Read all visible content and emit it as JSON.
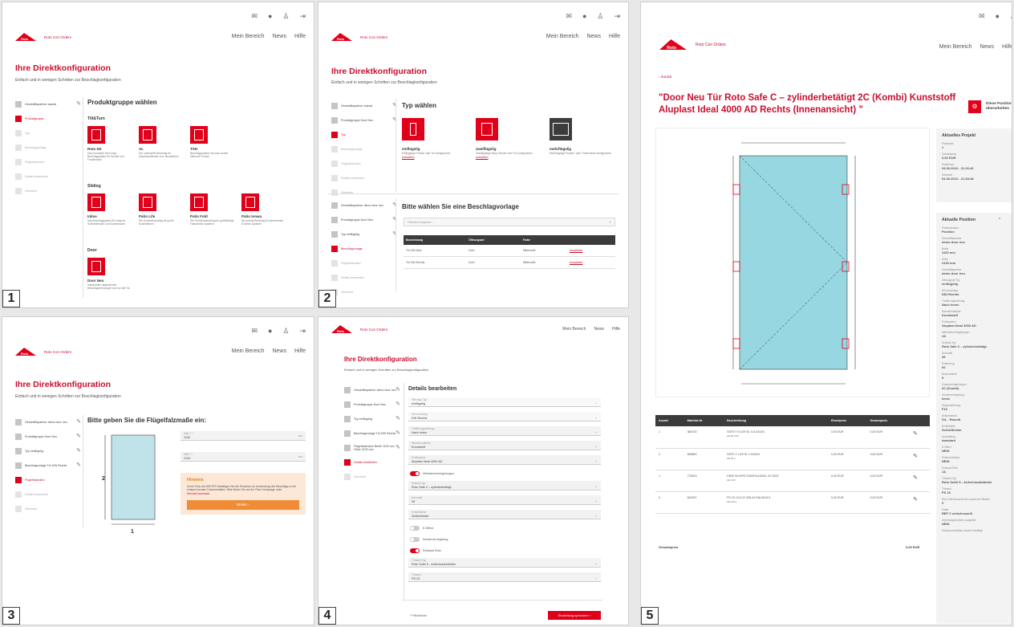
{
  "header": {
    "brand": "Roto Con Orders",
    "nav": [
      "Mein Bereich",
      "News",
      "Hilfe"
    ],
    "icons": [
      "mail-icon",
      "globe-icon",
      "user-icon",
      "logout-icon"
    ]
  },
  "heading": "Ihre Direktkonfiguration",
  "subheading": "Einfach und in wenigen Schritten zur Beschlagkonfiguration",
  "panel_numbers": [
    "1",
    "2",
    "3",
    "4",
    "5"
  ],
  "p1": {
    "steps": [
      {
        "label": "Geschäftspartner auswä",
        "state": "done",
        "edit": true
      },
      {
        "label": "Produktgruppe",
        "state": "active",
        "edit": false
      },
      {
        "label": "Typ",
        "state": "todo",
        "edit": false
      },
      {
        "label": "Beschlagvorlage",
        "state": "todo",
        "edit": false
      },
      {
        "label": "Flügelfalzmaße",
        "state": "todo",
        "edit": false
      },
      {
        "label": "Details bearbeiten",
        "state": "todo",
        "edit": false
      },
      {
        "label": "Übersicht",
        "state": "todo",
        "edit": false
      }
    ],
    "title": "Produktgruppe wählen",
    "groups": [
      {
        "title": "Tilt&Turn",
        "items": [
          {
            "name": "Roto NX",
            "desc": "Das innovative Dreh-Kipp-Beschlagsystem für Fenster und Fenstertüren"
          },
          {
            "name": "AL",
            "desc": "Der universelle Beschlag für Aluminiumfenster und -fenstertüren"
          },
          {
            "name": "TSH",
            "desc": "Beschlagsysteme für nach außen öffnende Fenster"
          }
        ]
      },
      {
        "title": "Sliding",
        "items": [
          {
            "name": "Inline",
            "desc": "Das Beschlagsystem für einfache Schiebefenster und Schiebetüren"
          },
          {
            "name": "Patio Life",
            "desc": "Der Komfortbeschlag für große Schiebetüren"
          },
          {
            "name": "Patio Fold",
            "desc": "Der Premiumbeschlag für großflächige Faltschiebe-Systeme"
          },
          {
            "name": "Patio Inowa",
            "desc": "Die smarte Beschlag für barrierefreie Schiebe-Systeme"
          }
        ]
      },
      {
        "title": "Door",
        "items": [
          {
            "name": "Door Neu",
            "desc": "Individueller abgestimmte Beschlagtechnologie rund um die Tür"
          }
        ]
      }
    ]
  },
  "p2": {
    "steps_a": [
      {
        "label": "Geschäftspartner auswä",
        "state": "done",
        "edit": true
      },
      {
        "label": "Produktgruppe Door Neu",
        "state": "done",
        "edit": true
      },
      {
        "label": "Typ",
        "state": "active",
        "edit": false
      },
      {
        "label": "Beschlagvorlage",
        "state": "todo",
        "edit": false
      },
      {
        "label": "Flügelfalzmaße",
        "state": "todo",
        "edit": false
      },
      {
        "label": "Details bearbeiten",
        "state": "todo",
        "edit": false
      },
      {
        "label": "Übersicht",
        "state": "todo",
        "edit": false
      }
    ],
    "type_title": "Typ wählen",
    "types": [
      {
        "name": "einflügelig",
        "desc": "Einflügelige Fenster oder Tür konfigurieren",
        "link": "Auswählen"
      },
      {
        "name": "zweiflügelig",
        "desc": "Zweiflügelige Stulp-Fenster oder Tür konfigurieren",
        "link": "Auswählen"
      },
      {
        "name": "mehrflügelig",
        "desc": "Mehrflügelige Fenster- oder Türelemente konfigurieren",
        "link": ""
      }
    ],
    "steps_b": [
      {
        "label": "Geschäftspartner demo door neu",
        "state": "done",
        "edit": true
      },
      {
        "label": "Produktgruppe Door Neu",
        "state": "done",
        "edit": true
      },
      {
        "label": "Typ einflügelig",
        "state": "done",
        "edit": true
      },
      {
        "label": "Beschlagvorlage",
        "state": "active",
        "edit": false
      },
      {
        "label": "Flügelfalzmaße",
        "state": "todo",
        "edit": false
      },
      {
        "label": "Details bearbeiten",
        "state": "todo",
        "edit": false
      },
      {
        "label": "Übersicht",
        "state": "todo",
        "edit": false
      }
    ],
    "template_title": "Bitte wählen Sie eine Beschlagvorlage",
    "search_placeholder": "Filtertext eingeben ...",
    "table_headers": [
      "Bezeichnung",
      "Öffnungsart",
      "Farbe",
      ""
    ],
    "rows": [
      [
        "Tür DIN links",
        "Dreh",
        "Silberweiß",
        "Auswählen"
      ],
      [
        "Tür DIN Rechts",
        "Dreh",
        "Silberweiß",
        "Auswählen"
      ]
    ]
  },
  "p3": {
    "steps": [
      {
        "label": "Geschäftspartner demo door neu",
        "state": "done",
        "edit": true
      },
      {
        "label": "Produktgruppe Door Neu",
        "state": "done",
        "edit": true
      },
      {
        "label": "Typ einflügelig",
        "state": "done",
        "edit": true
      },
      {
        "label": "Beschlagvorlage Tür DIN Rechts",
        "state": "done",
        "edit": true
      },
      {
        "label": "Flügelfalzmaße",
        "state": "active",
        "edit": false
      },
      {
        "label": "Details bearbeiten",
        "state": "todo",
        "edit": false
      },
      {
        "label": "Übersicht",
        "state": "todo",
        "edit": false
      }
    ],
    "title": "Bitte geben Sie die Flügelfalzmaße ein:",
    "dim_labels": [
      "2",
      "1"
    ],
    "fields": [
      {
        "label": "Maß 1 *",
        "value": "1100",
        "unit": "mm"
      },
      {
        "label": "Maß 2 *",
        "value": "2100",
        "unit": "mm"
      }
    ],
    "hint_title": "Hinweis",
    "hint_text": "Durch Klick auf WEITER bestätigen Sie die Hinweise zur Anwendung des Beschlags in der entsprechenden Dokumentation. Bitte finden Sie auf der Roto Homepage unter ",
    "hint_link": "ServiceDownloads",
    "next_button": "Weiter"
  },
  "p4": {
    "steps": [
      {
        "label": "Geschäftspartner demo door neu",
        "state": "done",
        "edit": true
      },
      {
        "label": "Produktgruppe Door Neu",
        "state": "done",
        "edit": true
      },
      {
        "label": "Typ einflügelig",
        "state": "done",
        "edit": true
      },
      {
        "label": "Beschlagvorlage Tür DIN Rechts",
        "state": "done",
        "edit": true
      },
      {
        "label": "Flügelfalzmaße Breite 1100 mm Höhe 2100 mm",
        "state": "done",
        "edit": true
      },
      {
        "label": "Details bearbeiten",
        "state": "active",
        "edit": false
      },
      {
        "label": "Übersicht",
        "state": "todo",
        "edit": false
      }
    ],
    "title": "Details bearbeiten",
    "rows": [
      {
        "kind": "field",
        "label": "Öffnungs-Typ",
        "value": "einflügelig",
        "disabled": true
      },
      {
        "kind": "field",
        "label": "DIN-Anschlag",
        "value": "DIN Rechts",
        "disabled": true
      },
      {
        "kind": "field",
        "label": "Türöffnungsrichtung",
        "value": "Nach innen"
      },
      {
        "kind": "field",
        "label": "Rahmenmaterial",
        "value": "Kunststoff"
      },
      {
        "kind": "field",
        "label": "Profilsystem",
        "value": "Aluplast Ideal 4000 AD"
      },
      {
        "kind": "toggle",
        "label": "Mehrfachverriegelungen",
        "on": true
      },
      {
        "kind": "field",
        "label": "Schloss-Typ",
        "value": "Roto Safe C - zylinderbetätigt"
      },
      {
        "kind": "field",
        "label": "Dornmaß",
        "value": "35"
      },
      {
        "kind": "field",
        "label": "Schließblech",
        "value": "Schließleiste"
      },
      {
        "kind": "toggle",
        "label": "E-Öffner",
        "on": false
      },
      {
        "kind": "toggle",
        "label": "Sonderverriegelung",
        "on": false
      },
      {
        "kind": "toggle",
        "label": "Eckband Roto",
        "on": true
      },
      {
        "kind": "field",
        "label": "Türband-Typ",
        "value": "Roto Solid S - Aufschraubbänder"
      },
      {
        "kind": "field",
        "label": "Türband",
        "value": "PS 23"
      }
    ],
    "required_note": "* Pflichtfelder",
    "save_button": "Einstellung speichern"
  },
  "p5": {
    "back": "Zurück",
    "title": "\"Door Neu Tür Roto Safe C – zylinderbetätigt 2C (Kombi) Kunststoff Aluplast Ideal 4000 AD Rechts (Innenansicht) \"",
    "edit_label": "Diese Position überarbeiten",
    "project_title": "Aktuelles Projekt",
    "project_kv": [
      {
        "k": "Positionen",
        "v": "1"
      },
      {
        "k": "Gesamtpreis",
        "v": "0,00 EUR"
      },
      {
        "k": "Erstellt am",
        "v": "04.06.2024 - 21:26:40"
      },
      {
        "k": "Geändert",
        "v": "04.06.2024 - 21:54:48"
      }
    ],
    "position_title": "Aktuelle Position",
    "position_kv": [
      {
        "k": "Positionsname",
        "v": "Position"
      },
      {
        "k": "Geschäftspartner",
        "v": "demo door neu"
      },
      {
        "k": "Breite",
        "v": "1100 mm"
      },
      {
        "k": "Höhe",
        "v": "2100 mm"
      },
      {
        "k": "Geschäftspartner",
        "v": "demo door neu"
      },
      {
        "k": "Öffnungsart Typ",
        "v": "einflügelig"
      },
      {
        "k": "DIN-Anschlag",
        "v": "DIN Rechts"
      },
      {
        "k": "Türöffnungsrichtung",
        "v": "Nach innen"
      },
      {
        "k": "Rahmenmaterial",
        "v": "Kunststoff"
      },
      {
        "k": "Profilsystem",
        "v": "Aluplast Ideal 4000 AD"
      },
      {
        "k": "Mehrfachverriegelungen",
        "v": "JA"
      },
      {
        "k": "Schloss-Typ",
        "v": "Roto Safe C - zylinderbetätigt"
      },
      {
        "k": "Dornmaß",
        "v": "35"
      },
      {
        "k": "Entfernung",
        "v": "92"
      },
      {
        "k": "Nussvariante",
        "v": "8"
      },
      {
        "k": "Zusatzverriegelungen",
        "v": "2C (Kombi)"
      },
      {
        "k": "Sonderverriegelung",
        "v": "keine"
      },
      {
        "k": "Stulpausführung",
        "v": "F16"
      },
      {
        "k": "Stulpmaterial",
        "v": "SiL - Rosolit"
      },
      {
        "k": "Schließteile",
        "v": "Schließleiste"
      },
      {
        "k": "Ausstattung",
        "v": "standard"
      },
      {
        "k": "E-Öffner",
        "v": "NEIN"
      },
      {
        "k": "Endverschlüsse",
        "v": "NEIN"
      },
      {
        "k": "Eckband Roto",
        "v": "JA"
      },
      {
        "k": "Türband-Typ",
        "v": "Roto Solid S - Aufschraubbänder"
      },
      {
        "k": "Türband",
        "v": "PS 23"
      },
      {
        "k": "Roto Solid Auswahl der Anzahl der Bänder",
        "v": "3"
      },
      {
        "k": "Farbe",
        "v": "REF 2 verkehrsweiß"
      },
      {
        "k": "Zeichnungsnummer ausgeben",
        "v": "NEIN"
      },
      {
        "k": "Einbauvorschriften wurden bestätigt.",
        "v": ""
      }
    ],
    "table_headers": [
      "Anzahl",
      "Material-Nr.",
      "Beschreibung",
      "Einzelpreis",
      "Gesamtpreis",
      ""
    ],
    "rows": [
      {
        "qty": "1",
        "mat": "386700",
        "desc": "SSTK F-9 U29 SL V-8 AS204",
        "sub": "DE.BLANK",
        "unit": "0,00 EUR",
        "total": "0,00 EUR"
      },
      {
        "qty": "2",
        "mat": "608663",
        "desc": "SSTK C U29 SL V AS204",
        "sub": "DE.BLC",
        "unit": "0,00 EUR",
        "total": "0,00 EUR"
      },
      {
        "qty": "1",
        "mat": "776523",
        "desc": "DS00 SL92PK D300F3x16/30L 2C 0203",
        "sub": "DE.CZ0",
        "unit": "0,00 EUR",
        "total": "0,00 EUR"
      },
      {
        "qty": "3",
        "mat": "810037",
        "desc": "PS 23 10,5-22 095-34 RAL9016 E",
        "sub": "DE.P023",
        "unit": "0,00 EUR",
        "total": "0,00 EUR"
      }
    ],
    "total_label": "Gesamtpreis",
    "total_value": "0,00 EUR"
  }
}
